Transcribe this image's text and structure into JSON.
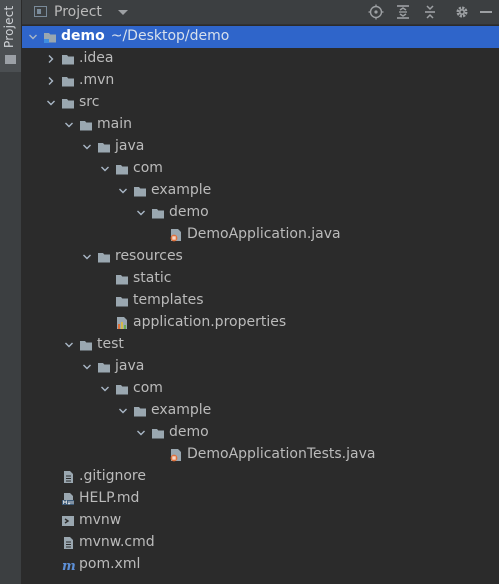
{
  "sidebar": {
    "tab_label": "Project"
  },
  "header": {
    "title": "Project",
    "buttons": [
      "locate-icon",
      "expand-all-icon",
      "collapse-all-icon",
      "gear-icon",
      "hide-icon"
    ]
  },
  "tree": [
    {
      "label": "demo",
      "path": "~/Desktop/demo",
      "depth": 0,
      "type": "module",
      "arrow": "down",
      "selected": true
    },
    {
      "label": ".idea",
      "depth": 1,
      "type": "folder",
      "arrow": "right"
    },
    {
      "label": ".mvn",
      "depth": 1,
      "type": "folder",
      "arrow": "right"
    },
    {
      "label": "src",
      "depth": 1,
      "type": "folder",
      "arrow": "down"
    },
    {
      "label": "main",
      "depth": 2,
      "type": "folder",
      "arrow": "down"
    },
    {
      "label": "java",
      "depth": 3,
      "type": "folder",
      "arrow": "down"
    },
    {
      "label": "com",
      "depth": 4,
      "type": "folder",
      "arrow": "down"
    },
    {
      "label": "example",
      "depth": 5,
      "type": "folder",
      "arrow": "down"
    },
    {
      "label": "demo",
      "depth": 6,
      "type": "folder",
      "arrow": "down"
    },
    {
      "label": "DemoApplication.java",
      "depth": 7,
      "type": "java"
    },
    {
      "label": "resources",
      "depth": 3,
      "type": "folder",
      "arrow": "down"
    },
    {
      "label": "static",
      "depth": 4,
      "type": "folder"
    },
    {
      "label": "templates",
      "depth": 4,
      "type": "folder"
    },
    {
      "label": "application.properties",
      "depth": 4,
      "type": "properties"
    },
    {
      "label": "test",
      "depth": 2,
      "type": "folder",
      "arrow": "down"
    },
    {
      "label": "java",
      "depth": 3,
      "type": "folder",
      "arrow": "down"
    },
    {
      "label": "com",
      "depth": 4,
      "type": "folder",
      "arrow": "down"
    },
    {
      "label": "example",
      "depth": 5,
      "type": "folder",
      "arrow": "down"
    },
    {
      "label": "demo",
      "depth": 6,
      "type": "folder",
      "arrow": "down"
    },
    {
      "label": "DemoApplicationTests.java",
      "depth": 7,
      "type": "java"
    },
    {
      "label": ".gitignore",
      "depth": 1,
      "type": "textfile"
    },
    {
      "label": "HELP.md",
      "depth": 1,
      "type": "markdown"
    },
    {
      "label": "mvnw",
      "depth": 1,
      "type": "shell"
    },
    {
      "label": "mvnw.cmd",
      "depth": 1,
      "type": "textfile"
    },
    {
      "label": "pom.xml",
      "depth": 1,
      "type": "maven"
    }
  ],
  "colors": {
    "selection": "#2f65ca",
    "panel_bg": "#2b2b2b",
    "text": "#bbbbbb",
    "folder_icon": "#9aa7b0",
    "java_icon_accent": "#e0703a"
  }
}
